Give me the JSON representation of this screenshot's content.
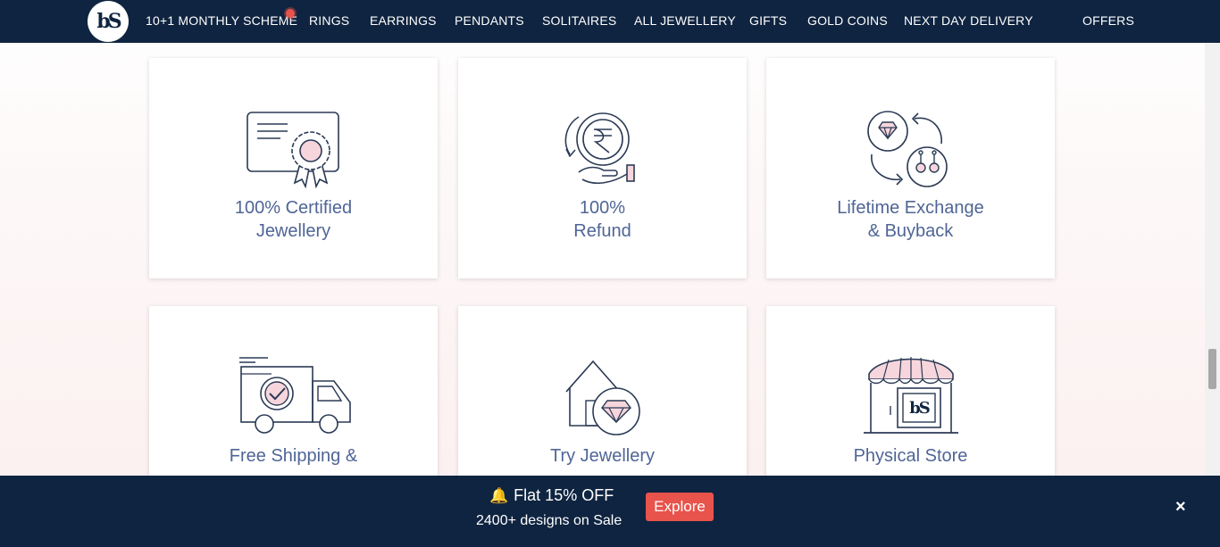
{
  "nav": {
    "logo_text": "bS",
    "items": [
      {
        "label": "10+1 MONTHLY SCHEME"
      },
      {
        "label": "RINGS"
      },
      {
        "label": "EARRINGS"
      },
      {
        "label": "PENDANTS"
      },
      {
        "label": "SOLITAIRES"
      },
      {
        "label": "ALL JEWELLERY"
      },
      {
        "label": "GIFTS"
      },
      {
        "label": "GOLD COINS"
      },
      {
        "label": "NEXT DAY DELIVERY"
      },
      {
        "label": "OFFERS"
      }
    ]
  },
  "features": [
    {
      "line1": "100% Certified",
      "line2": "Jewellery",
      "icon": "certificate-icon"
    },
    {
      "line1": "100%",
      "line2": "Refund",
      "icon": "rupee-refund-icon"
    },
    {
      "line1": "Lifetime Exchange",
      "line2": "& Buyback",
      "icon": "exchange-icon"
    },
    {
      "line1": "Free Shipping &",
      "line2": "",
      "icon": "delivery-truck-icon"
    },
    {
      "line1": "Try Jewellery",
      "line2": "",
      "icon": "try-at-home-icon"
    },
    {
      "line1": "Physical Store",
      "line2": "",
      "icon": "store-icon"
    }
  ],
  "offer_bar": {
    "title": "Flat 15% OFF",
    "subtitle": "2400+ designs on Sale",
    "button": "Explore",
    "close": "×"
  },
  "colors": {
    "nav_bg": "#0f2440",
    "accent": "#e8534c",
    "label_text": "#4f6596",
    "icon_stroke": "#2b3a55",
    "icon_fill_pink": "#f6d6dc"
  }
}
